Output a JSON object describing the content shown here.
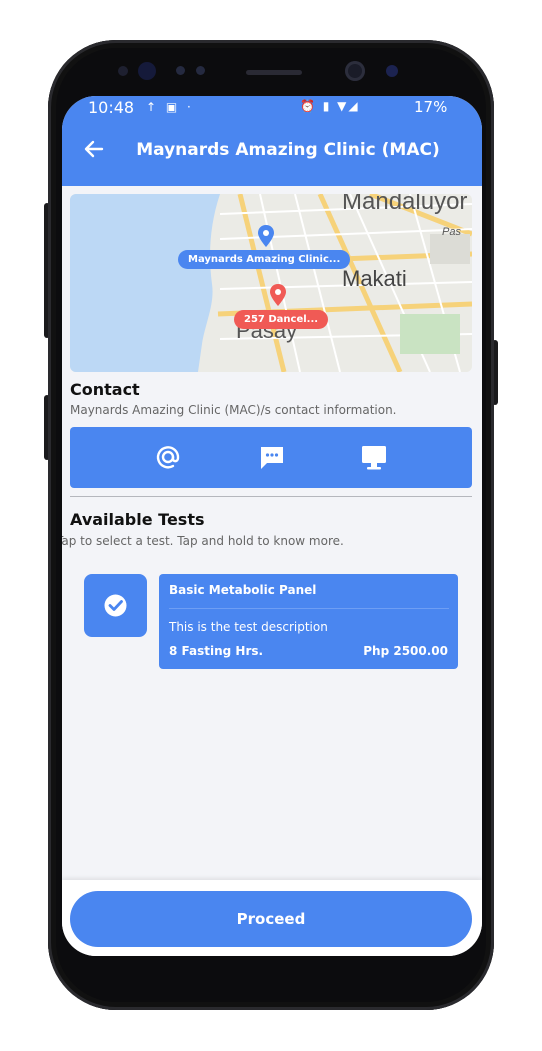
{
  "status_bar": {
    "time": "10:48",
    "left_icons": "↑ ▣ ·",
    "right_icons": "⏰ ▮ ▼◢",
    "battery": "17%"
  },
  "app_bar": {
    "title": "Maynards Amazing Clinic (MAC)",
    "back_icon": "arrow-left-icon"
  },
  "map": {
    "clinic_marker_label": "Maynards Amazing Clinic...",
    "user_marker_label": "257 Dancel...",
    "place_names": [
      "Mandaluyor",
      "Pas",
      "Makati",
      "Pasay"
    ],
    "clinic_marker_color": "#4a86f0",
    "user_marker_color": "#f05a55"
  },
  "contact": {
    "heading": "Contact",
    "subtitle": "Maynards Amazing Clinic (MAC)/s contact information.",
    "icons": [
      "email-icon",
      "message-icon",
      "website-icon"
    ]
  },
  "tests": {
    "heading": "Available Tests",
    "subtitle": "Tap to select a test. Tap and hold to know more.",
    "items": [
      {
        "name": "Basic Metabolic Panel",
        "description": "This is the test description",
        "fasting": "8 Fasting Hrs.",
        "price": "Php 2500.00",
        "selected": true
      }
    ]
  },
  "footer": {
    "proceed_label": "Proceed"
  },
  "colors": {
    "primary": "#4a86f0",
    "background": "#f3f4f8"
  }
}
